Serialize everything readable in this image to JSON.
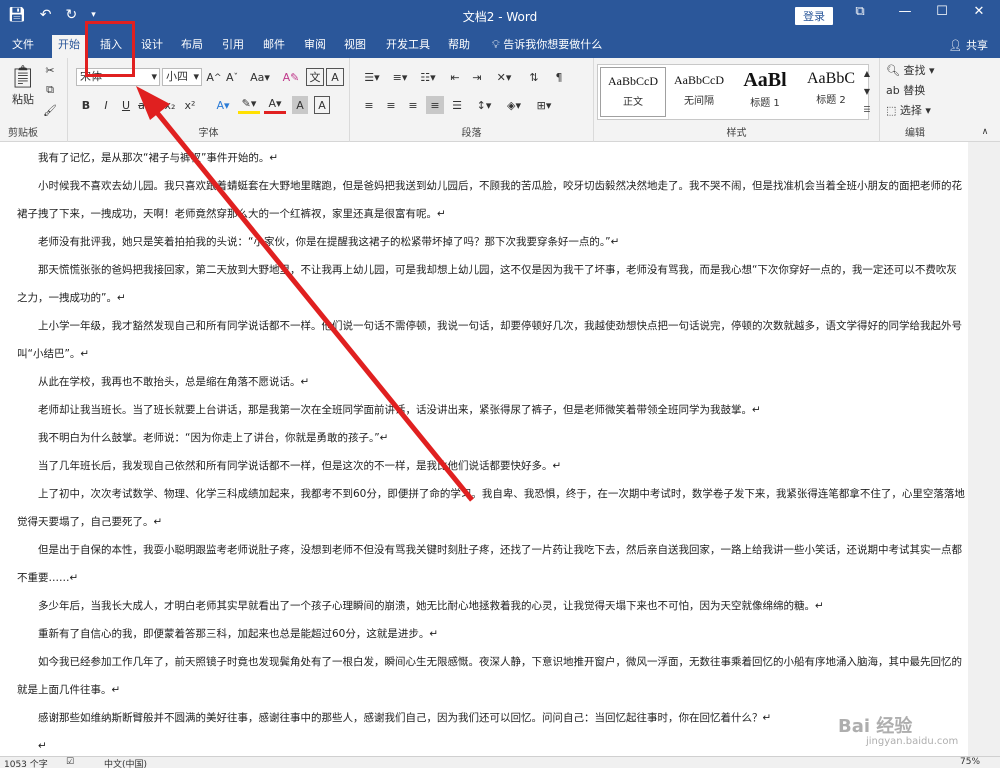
{
  "titlebar": {
    "title": "文档2 - Word",
    "login": "登录",
    "save_icon": "save-icon",
    "undo_icon": "undo-icon",
    "redo_icon": "redo-icon",
    "minimize": "—",
    "maximize": "☐",
    "close": "✕",
    "restore": "⧉"
  },
  "tabs": {
    "items": [
      "文件",
      "开始",
      "插入",
      "设计",
      "布局",
      "引用",
      "邮件",
      "审阅",
      "视图",
      "开发工具",
      "帮助"
    ],
    "tell_me": "告诉我你想要做什么",
    "share": "共享"
  },
  "ribbon": {
    "clipboard": {
      "label": "剪贴板",
      "paste": "粘贴"
    },
    "font": {
      "label": "字体",
      "font_name": "宋体",
      "font_size": "小四"
    },
    "paragraph": {
      "label": "段落"
    },
    "styles": {
      "label": "样式",
      "items": [
        {
          "sample": "AaBbCcD",
          "name": "正文"
        },
        {
          "sample": "AaBbCcD",
          "name": "无间隔"
        },
        {
          "sample": "AaBl",
          "name": "标题 1"
        },
        {
          "sample": "AaBbC",
          "name": "标题 2"
        }
      ]
    },
    "editing": {
      "label": "编辑",
      "find": "查找",
      "replace": "替换",
      "select": "选择"
    }
  },
  "document": {
    "paragraphs": [
      "我有了记忆，是从那次“裙子与裤衩”事件开始的。↵",
      "小时候我不喜欢去幼儿园。我只喜欢跟着蜻蜓套在大野地里瞎跑，但是爸妈把我送到幼儿园后，不顾我的苦瓜脸，咬牙切齿毅然决然地走了。我不哭不闹，但是找准机会当着全班小朋友的面把老师的花裙子拽了下来，一拽成功，天啊！老师竟然穿那么大的一个红裤衩，家里还真是很富有呢。↵",
      "老师没有批评我，她只是笑着拍拍我的头说：“小家伙，你是在提醒我这裙子的松紧带坏掉了吗？那下次我要穿条好一点的。”↵",
      "那天慌慌张张的爸妈把我接回家，第二天放到大野地里，不让我再上幼儿园，可是我却想上幼儿园，这不仅是因为我干了坏事，老师没有骂我，而是我心想“下次你穿好一点的，我一定还可以不费吹灰之力，一拽成功的”。↵",
      "上小学一年级，我才豁然发现自己和所有同学说话都不一样。他们说一句话不需停顿，我说一句话，却要停顿好几次，我越使劲想快点把一句话说完，停顿的次数就越多，语文学得好的同学给我起外号叫“小结巴”。↵",
      "从此在学校，我再也不敢抬头，总是缩在角落不愿说话。↵",
      "老师却让我当班长。当了班长就要上台讲话，那是我第一次在全班同学面前讲话，话没讲出来，紧张得尿了裤子，但是老师微笑着带领全班同学为我鼓掌。↵",
      "我不明白为什么鼓掌。老师说：“因为你走上了讲台，你就是勇敢的孩子。”↵",
      "当了几年班长后，我发现自己依然和所有同学说话都不一样，但是这次的不一样，是我比他们说话都要快好多。↵",
      "上了初中，次次考试数学、物理、化学三科成绩加起来，我都考不到60分，即便拼了命的学习。我自卑、我恐惧，终于，在一次期中考试时，数学卷子发下来，我紧张得连笔都拿不住了，心里空落落地觉得天要塌了，自己要死了。↵",
      "但是出于自保的本性，我耍小聪明跟监考老师说肚子疼，没想到老师不但没有骂我关键时刻肚子疼，还找了一片药让我吃下去，然后亲自送我回家，一路上给我讲一些小笑话，还说期中考试其实一点都不重要……↵",
      "多少年后，当我长大成人，才明白老师其实早就看出了一个孩子心理瞬间的崩溃，她无比耐心地拯救着我的心灵，让我觉得天塌下来也不可怕，因为天空就像绵绵的糖。↵",
      "重新有了自信心的我，即便蒙着答那三科，加起来也总是能超过60分，这就是进步。↵",
      "如今我已经参加工作几年了，前天照镜子时竟也发现鬓角处有了一根白发，瞬间心生无限感慨。夜深人静，下意识地推开窗户，微风一浮面，无数往事乘着回忆的小船有序地涌入脑海，其中最先回忆的就是上面几件往事。↵",
      "感谢那些如维纳斯断臂般并不圆满的美好往事，感谢往事中的那些人，感谢我们自己，因为我们还可以回忆。问问自己：当回忆起往事时，你在回忆着什么？↵",
      "↵"
    ]
  },
  "statusbar": {
    "word_count": "1053 个字",
    "language": "中文(中国)",
    "zoom": "75%"
  },
  "watermark": {
    "brand": "Bai 经验",
    "url": "jingyan.baidu.com"
  }
}
